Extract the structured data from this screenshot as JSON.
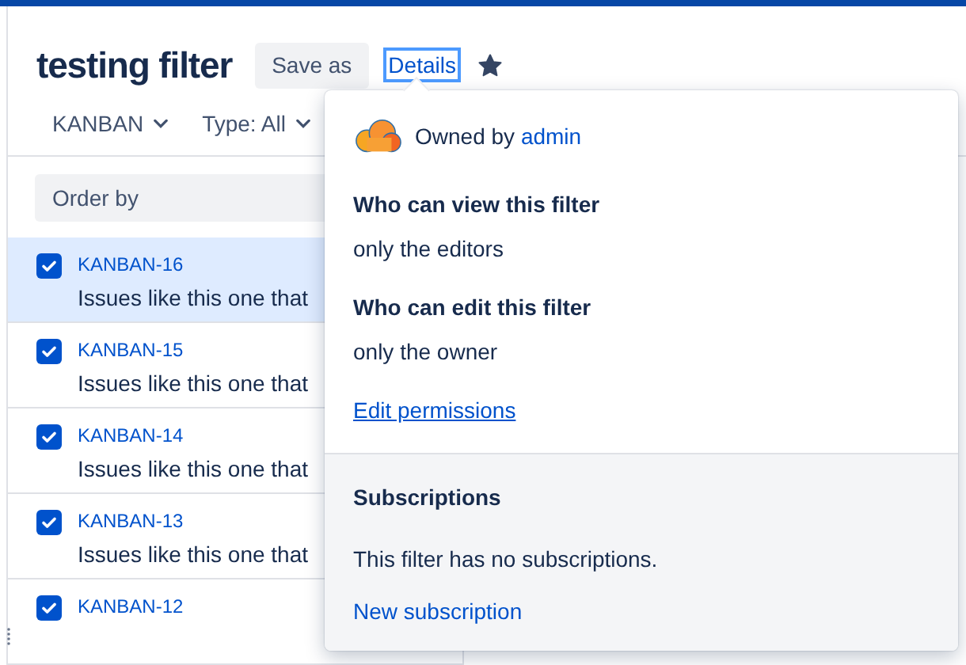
{
  "header": {
    "title": "testing filter",
    "save_as": "Save as",
    "details": "Details",
    "starred": true
  },
  "filters": [
    {
      "label": "KANBAN"
    },
    {
      "label": "Type: All"
    }
  ],
  "order_by": {
    "placeholder": "Order by"
  },
  "issues": [
    {
      "key": "KANBAN-16",
      "summary": "Issues like this one that",
      "checked": true,
      "selected": true
    },
    {
      "key": "KANBAN-15",
      "summary": "Issues like this one that",
      "checked": true,
      "selected": false
    },
    {
      "key": "KANBAN-14",
      "summary": "Issues like this one that",
      "checked": true,
      "selected": false
    },
    {
      "key": "KANBAN-13",
      "summary": "Issues like this one that",
      "checked": true,
      "selected": false
    },
    {
      "key": "KANBAN-12",
      "checked": true,
      "selected": false
    }
  ],
  "details_popover": {
    "owner_prefix": "Owned by",
    "owner": "admin",
    "sections": [
      {
        "heading": "Who can view this filter",
        "value": "only the editors"
      },
      {
        "heading": "Who can edit this filter",
        "value": "only the owner"
      }
    ],
    "edit_link": "Edit permissions",
    "subscriptions": {
      "heading": "Subscriptions",
      "message": "This filter has no subscriptions.",
      "link": "New subscription"
    }
  }
}
